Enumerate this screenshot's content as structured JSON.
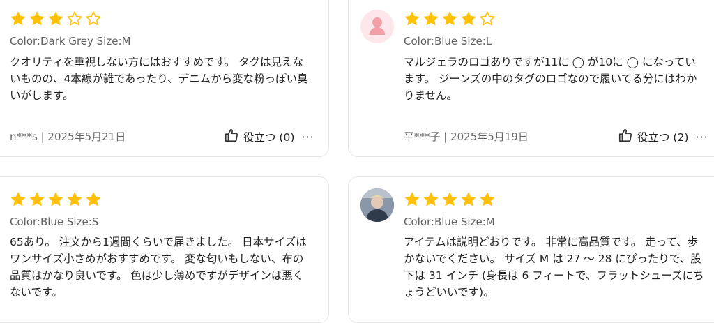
{
  "reviews": [
    {
      "rating": 3,
      "meta": "Color:Dark Grey Size:M",
      "text": "クオリティを重視しない方にはおすすめです。 タグは見えないものの、4本線が雑であったり、デニムから変な粉っぽい臭いがします。",
      "author_date": "n***s | 2025年5月21日",
      "helpful_label": "役立つ (0)",
      "more_label": "···"
    },
    {
      "rating": 4,
      "avatar": "default-user-avatar",
      "meta": "Color:Blue Size:L",
      "text": "マルジェラのロゴありですが11に ◯ が10に ◯ になっています。 ジーンズの中のタグのロゴなので履いてる分にはわかりません。",
      "author_date": "平***子 | 2025年5月19日",
      "helpful_label": "役立つ (2)",
      "more_label": "···"
    },
    {
      "rating": 5,
      "meta": "Color:Blue Size:S",
      "text": "65あり。 注文から1週間くらいで届きました。 日本サイズはワンサイズ小さめがおすすめです。 変な匂いもしない、布の品質はかなり良いです。 色は少し薄めですがデザインは悪くないです。"
    },
    {
      "rating": 5,
      "avatar": "user-photo-avatar",
      "meta": "Color:Blue Size:M",
      "text": "アイテムは説明どおりです。 非常に高品質です。 走って、歩かないでください。 サイズ M は 27 ～ 28 にぴったりで、股下は 31 インチ (身長は 6 フィートで、フラットシューズにちょうどいいです)。"
    }
  ],
  "colors": {
    "star_filled": "#ffc107",
    "star_empty": "#ffc107",
    "border": "#e6e6e6"
  },
  "icons": {
    "star": "star-icon",
    "thumbs_up": "thumbs-up-icon",
    "more": "more-options-icon"
  }
}
